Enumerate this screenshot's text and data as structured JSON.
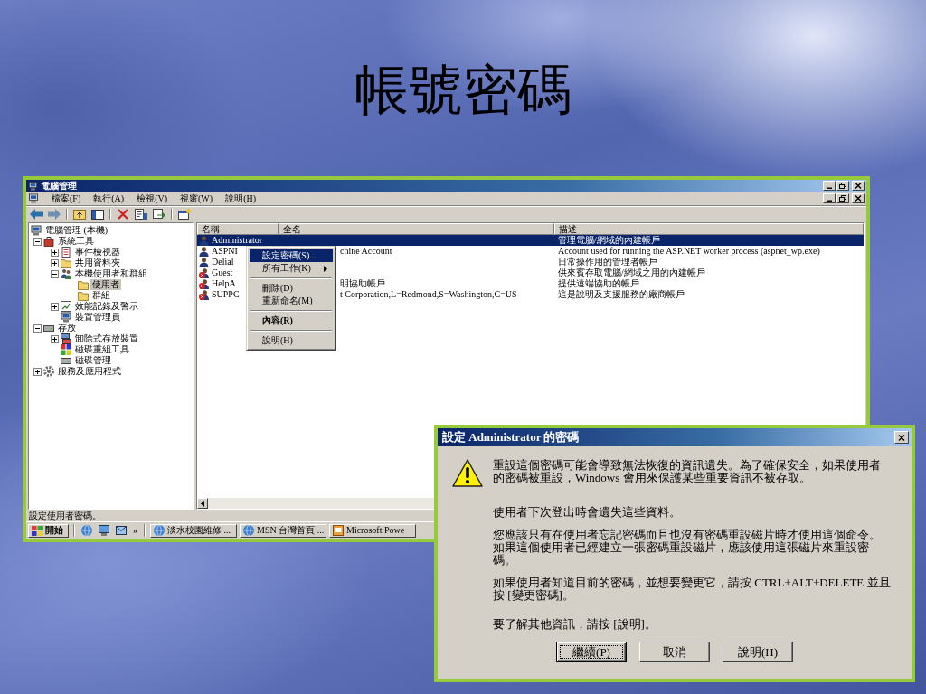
{
  "slide": {
    "title": "帳號密碼"
  },
  "window": {
    "title": "電腦管理",
    "menus": [
      {
        "label": "檔案(F)"
      },
      {
        "label": "執行(A)"
      },
      {
        "label": "檢視(V)"
      },
      {
        "label": "視窗(W)"
      },
      {
        "label": "說明(H)"
      }
    ],
    "tree": {
      "items": [
        {
          "label": "電腦管理 (本機)",
          "selected": false,
          "children": [
            {
              "label": "系統工具",
              "selected": false,
              "expanded": true,
              "children": [
                {
                  "label": "事件檢視器",
                  "selected": false,
                  "expanded": false
                },
                {
                  "label": "共用資料夾",
                  "selected": false,
                  "expanded": false
                },
                {
                  "label": "本機使用者和群組",
                  "selected": false,
                  "expanded": true,
                  "children": [
                    {
                      "label": "使用者",
                      "selected": true
                    },
                    {
                      "label": "群組",
                      "selected": false
                    }
                  ]
                },
                {
                  "label": "效能記錄及警示",
                  "selected": false,
                  "expanded": false
                },
                {
                  "label": "裝置管理員",
                  "selected": false
                }
              ]
            },
            {
              "label": "存放",
              "selected": false,
              "expanded": true,
              "children": [
                {
                  "label": "卸除式存放裝置",
                  "selected": false,
                  "expanded": false
                },
                {
                  "label": "磁碟重組工具",
                  "selected": false
                },
                {
                  "label": "磁碟管理",
                  "selected": false
                }
              ]
            },
            {
              "label": "服務及應用程式",
              "selected": false,
              "expanded": false
            }
          ]
        }
      ]
    },
    "list": {
      "columns": [
        "名稱",
        "全名",
        "描述"
      ],
      "rows": [
        {
          "name": "Administrator",
          "description": "管理電腦/網域的內建帳戶",
          "selected": true,
          "disabled": false
        },
        {
          "name": "ASPNI",
          "full_name": "chine Account",
          "description": "Account used for running the ASP.NET worker process (aspnet_wp.exe)",
          "selected": false,
          "disabled": false
        },
        {
          "name": "Delial",
          "description": "日常操作用的管理者帳戶",
          "selected": false,
          "disabled": false
        },
        {
          "name": "Guest",
          "description": "供來賓存取電腦/網域之用的內建帳戶",
          "selected": false,
          "disabled": true
        },
        {
          "name": "HelpA",
          "full_name": "明協助帳戶",
          "description": "提供遠端協助的帳戶",
          "selected": false,
          "disabled": true
        },
        {
          "name": "SUPPC",
          "full_name": "t Corporation,L=Redmond,S=Washington,C=US",
          "description": "這是說明及支援服務的廠商帳戶",
          "selected": false,
          "disabled": true
        }
      ]
    },
    "context_menu": {
      "groups": [
        {
          "items": [
            {
              "label": "設定密碼(S)...",
              "selected": true,
              "submenu": false,
              "default": false
            },
            {
              "label": "所有工作(K)",
              "selected": false,
              "submenu": true,
              "default": false
            }
          ]
        },
        {
          "items": [
            {
              "label": "刪除(D)",
              "selected": false,
              "submenu": false,
              "default": false
            },
            {
              "label": "重新命名(M)",
              "selected": false,
              "submenu": false,
              "default": false
            }
          ]
        },
        {
          "items": [
            {
              "label": "內容(R)",
              "selected": false,
              "submenu": false,
              "default": true
            }
          ]
        },
        {
          "items": [
            {
              "label": "說明(H)",
              "selected": false,
              "submenu": false,
              "default": false
            }
          ]
        }
      ]
    },
    "status_bar": {
      "text": "設定使用者密碼。"
    }
  },
  "taskbar": {
    "start": "開始",
    "more": "»",
    "tasks": [
      {
        "label": "淡水校園維修 ..."
      },
      {
        "label": "MSN 台灣首頁 ..."
      },
      {
        "label": "Microsoft Powe"
      }
    ]
  },
  "dialog": {
    "title": "設定 Administrator 的密碼",
    "blocks": [
      {
        "texts": [
          "重設這個密碼可能會導致無法恢復的資訊遺失。為了確保安全，如果使用者的密碼被重設，Windows 會用來保護某些重要資訊不被存取。"
        ]
      },
      {
        "texts": [
          "使用者下次登出時會遺失這些資料。"
        ]
      },
      {
        "texts": [
          "您應該只有在使用者忘記密碼而且也沒有密碼重設磁片時才使用這個命令。",
          "如果這個使用者已經建立一張密碼重設磁片，應該使用這張磁片來重設密碼。"
        ]
      },
      {
        "texts": [
          "如果使用者知道目前的密碼，並想要變更它，請按 CTRL+ALT+DELETE 並且按 [變更密碼]。"
        ]
      },
      {
        "texts": [
          "要了解其他資訊，請按 [說明]。"
        ]
      }
    ],
    "buttons": [
      {
        "label": "繼續(P)",
        "default": true
      },
      {
        "label": "取消",
        "default": false
      },
      {
        "label": "說明(H)",
        "default": false
      }
    ]
  }
}
